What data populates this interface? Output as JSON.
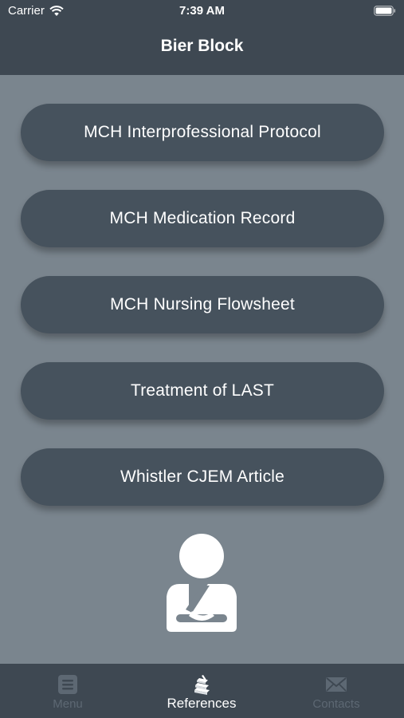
{
  "status_bar": {
    "carrier": "Carrier",
    "time": "7:39 AM"
  },
  "nav": {
    "title": "Bier Block"
  },
  "references": [
    {
      "label": "MCH Interprofessional Protocol"
    },
    {
      "label": "MCH Medication Record"
    },
    {
      "label": "MCH Nursing Flowsheet"
    },
    {
      "label": "Treatment of LAST"
    },
    {
      "label": "Whistler CJEM Article"
    }
  ],
  "tab_bar": {
    "tabs": [
      {
        "label": "Menu",
        "icon": "menu-list-icon",
        "active": false
      },
      {
        "label": "References",
        "icon": "books-icon",
        "active": true
      },
      {
        "label": "Contacts",
        "icon": "envelope-icon",
        "active": false
      }
    ]
  },
  "colors": {
    "header_bg": "#3e4852",
    "content_bg": "#7a858e",
    "button_bg": "#46525d",
    "tab_inactive": "#5d6873",
    "text": "#ffffff"
  }
}
